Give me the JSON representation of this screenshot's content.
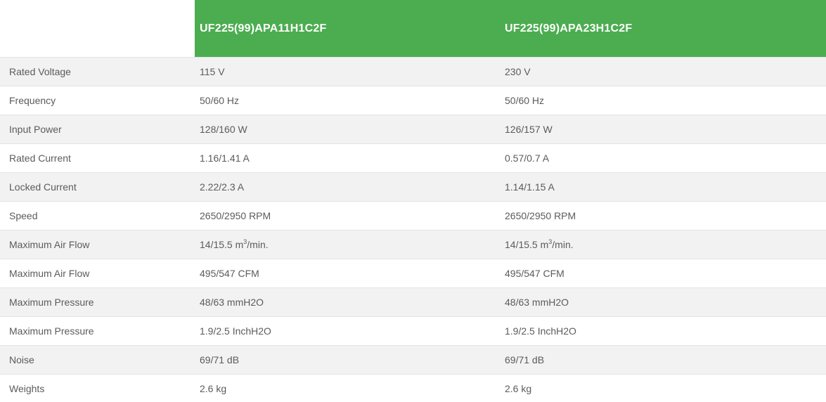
{
  "table": {
    "columns": [
      {
        "label": "UF225(99)APA11H1C2F"
      },
      {
        "label": "UF225(99)APA23H1C2F"
      }
    ],
    "rows": [
      {
        "label": "Rated Voltage",
        "values": [
          "115 V",
          "230 V"
        ]
      },
      {
        "label": "Frequency",
        "values": [
          "50/60 Hz",
          "50/60 Hz"
        ]
      },
      {
        "label": "Input Power",
        "values": [
          "128/160 W",
          "126/157 W"
        ]
      },
      {
        "label": "Rated Current",
        "values": [
          "1.16/1.41 A",
          "0.57/0.7 A"
        ]
      },
      {
        "label": "Locked Current",
        "values": [
          "2.22/2.3 A",
          "1.14/1.15 A"
        ]
      },
      {
        "label": "Speed",
        "values": [
          "2650/2950 RPM",
          "2650/2950 RPM"
        ]
      },
      {
        "label": "Maximum Air Flow",
        "values": [
          [
            {
              "t": "14/15.5 m"
            },
            {
              "t": "3",
              "sup": true
            },
            {
              "t": "/min."
            }
          ],
          [
            {
              "t": "14/15.5 m"
            },
            {
              "t": "3",
              "sup": true
            },
            {
              "t": "/min."
            }
          ]
        ]
      },
      {
        "label": "Maximum Air Flow",
        "values": [
          "495/547 CFM",
          "495/547 CFM"
        ]
      },
      {
        "label": "Maximum Pressure",
        "values": [
          "48/63 mmH2O",
          "48/63 mmH2O"
        ]
      },
      {
        "label": "Maximum Pressure",
        "values": [
          "1.9/2.5 InchH2O",
          "1.9/2.5 InchH2O"
        ]
      },
      {
        "label": "Noise",
        "values": [
          "69/71 dB",
          "69/71 dB"
        ]
      },
      {
        "label": "Weights",
        "values": [
          "2.6 kg",
          "2.6 kg"
        ]
      }
    ]
  },
  "colors": {
    "header_green": "#4bad4f",
    "header_text": "#ffffff",
    "row_shaded": "#f2f2f2",
    "row_plain": "#ffffff",
    "row_border": "#e4e4e4",
    "text": "#5b5b5b"
  }
}
